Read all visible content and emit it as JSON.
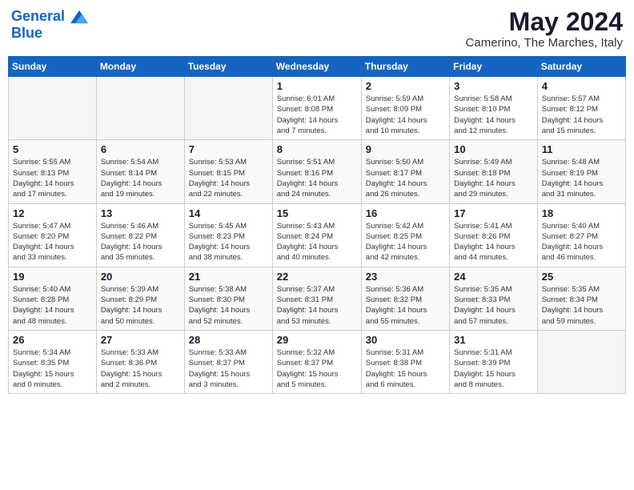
{
  "header": {
    "logo_line1": "General",
    "logo_line2": "Blue",
    "month_year": "May 2024",
    "location": "Camerino, The Marches, Italy"
  },
  "weekdays": [
    "Sunday",
    "Monday",
    "Tuesday",
    "Wednesday",
    "Thursday",
    "Friday",
    "Saturday"
  ],
  "weeks": [
    [
      {
        "day": "",
        "info": ""
      },
      {
        "day": "",
        "info": ""
      },
      {
        "day": "",
        "info": ""
      },
      {
        "day": "1",
        "info": "Sunrise: 6:01 AM\nSunset: 8:08 PM\nDaylight: 14 hours\nand 7 minutes."
      },
      {
        "day": "2",
        "info": "Sunrise: 5:59 AM\nSunset: 8:09 PM\nDaylight: 14 hours\nand 10 minutes."
      },
      {
        "day": "3",
        "info": "Sunrise: 5:58 AM\nSunset: 8:10 PM\nDaylight: 14 hours\nand 12 minutes."
      },
      {
        "day": "4",
        "info": "Sunrise: 5:57 AM\nSunset: 8:12 PM\nDaylight: 14 hours\nand 15 minutes."
      }
    ],
    [
      {
        "day": "5",
        "info": "Sunrise: 5:55 AM\nSunset: 8:13 PM\nDaylight: 14 hours\nand 17 minutes."
      },
      {
        "day": "6",
        "info": "Sunrise: 5:54 AM\nSunset: 8:14 PM\nDaylight: 14 hours\nand 19 minutes."
      },
      {
        "day": "7",
        "info": "Sunrise: 5:53 AM\nSunset: 8:15 PM\nDaylight: 14 hours\nand 22 minutes."
      },
      {
        "day": "8",
        "info": "Sunrise: 5:51 AM\nSunset: 8:16 PM\nDaylight: 14 hours\nand 24 minutes."
      },
      {
        "day": "9",
        "info": "Sunrise: 5:50 AM\nSunset: 8:17 PM\nDaylight: 14 hours\nand 26 minutes."
      },
      {
        "day": "10",
        "info": "Sunrise: 5:49 AM\nSunset: 8:18 PM\nDaylight: 14 hours\nand 29 minutes."
      },
      {
        "day": "11",
        "info": "Sunrise: 5:48 AM\nSunset: 8:19 PM\nDaylight: 14 hours\nand 31 minutes."
      }
    ],
    [
      {
        "day": "12",
        "info": "Sunrise: 5:47 AM\nSunset: 8:20 PM\nDaylight: 14 hours\nand 33 minutes."
      },
      {
        "day": "13",
        "info": "Sunrise: 5:46 AM\nSunset: 8:22 PM\nDaylight: 14 hours\nand 35 minutes."
      },
      {
        "day": "14",
        "info": "Sunrise: 5:45 AM\nSunset: 8:23 PM\nDaylight: 14 hours\nand 38 minutes."
      },
      {
        "day": "15",
        "info": "Sunrise: 5:43 AM\nSunset: 8:24 PM\nDaylight: 14 hours\nand 40 minutes."
      },
      {
        "day": "16",
        "info": "Sunrise: 5:42 AM\nSunset: 8:25 PM\nDaylight: 14 hours\nand 42 minutes."
      },
      {
        "day": "17",
        "info": "Sunrise: 5:41 AM\nSunset: 8:26 PM\nDaylight: 14 hours\nand 44 minutes."
      },
      {
        "day": "18",
        "info": "Sunrise: 5:40 AM\nSunset: 8:27 PM\nDaylight: 14 hours\nand 46 minutes."
      }
    ],
    [
      {
        "day": "19",
        "info": "Sunrise: 5:40 AM\nSunset: 8:28 PM\nDaylight: 14 hours\nand 48 minutes."
      },
      {
        "day": "20",
        "info": "Sunrise: 5:39 AM\nSunset: 8:29 PM\nDaylight: 14 hours\nand 50 minutes."
      },
      {
        "day": "21",
        "info": "Sunrise: 5:38 AM\nSunset: 8:30 PM\nDaylight: 14 hours\nand 52 minutes."
      },
      {
        "day": "22",
        "info": "Sunrise: 5:37 AM\nSunset: 8:31 PM\nDaylight: 14 hours\nand 53 minutes."
      },
      {
        "day": "23",
        "info": "Sunrise: 5:36 AM\nSunset: 8:32 PM\nDaylight: 14 hours\nand 55 minutes."
      },
      {
        "day": "24",
        "info": "Sunrise: 5:35 AM\nSunset: 8:33 PM\nDaylight: 14 hours\nand 57 minutes."
      },
      {
        "day": "25",
        "info": "Sunrise: 5:35 AM\nSunset: 8:34 PM\nDaylight: 14 hours\nand 59 minutes."
      }
    ],
    [
      {
        "day": "26",
        "info": "Sunrise: 5:34 AM\nSunset: 8:35 PM\nDaylight: 15 hours\nand 0 minutes."
      },
      {
        "day": "27",
        "info": "Sunrise: 5:33 AM\nSunset: 8:36 PM\nDaylight: 15 hours\nand 2 minutes."
      },
      {
        "day": "28",
        "info": "Sunrise: 5:33 AM\nSunset: 8:37 PM\nDaylight: 15 hours\nand 3 minutes."
      },
      {
        "day": "29",
        "info": "Sunrise: 5:32 AM\nSunset: 8:37 PM\nDaylight: 15 hours\nand 5 minutes."
      },
      {
        "day": "30",
        "info": "Sunrise: 5:31 AM\nSunset: 8:38 PM\nDaylight: 15 hours\nand 6 minutes."
      },
      {
        "day": "31",
        "info": "Sunrise: 5:31 AM\nSunset: 8:39 PM\nDaylight: 15 hours\nand 8 minutes."
      },
      {
        "day": "",
        "info": ""
      }
    ]
  ]
}
